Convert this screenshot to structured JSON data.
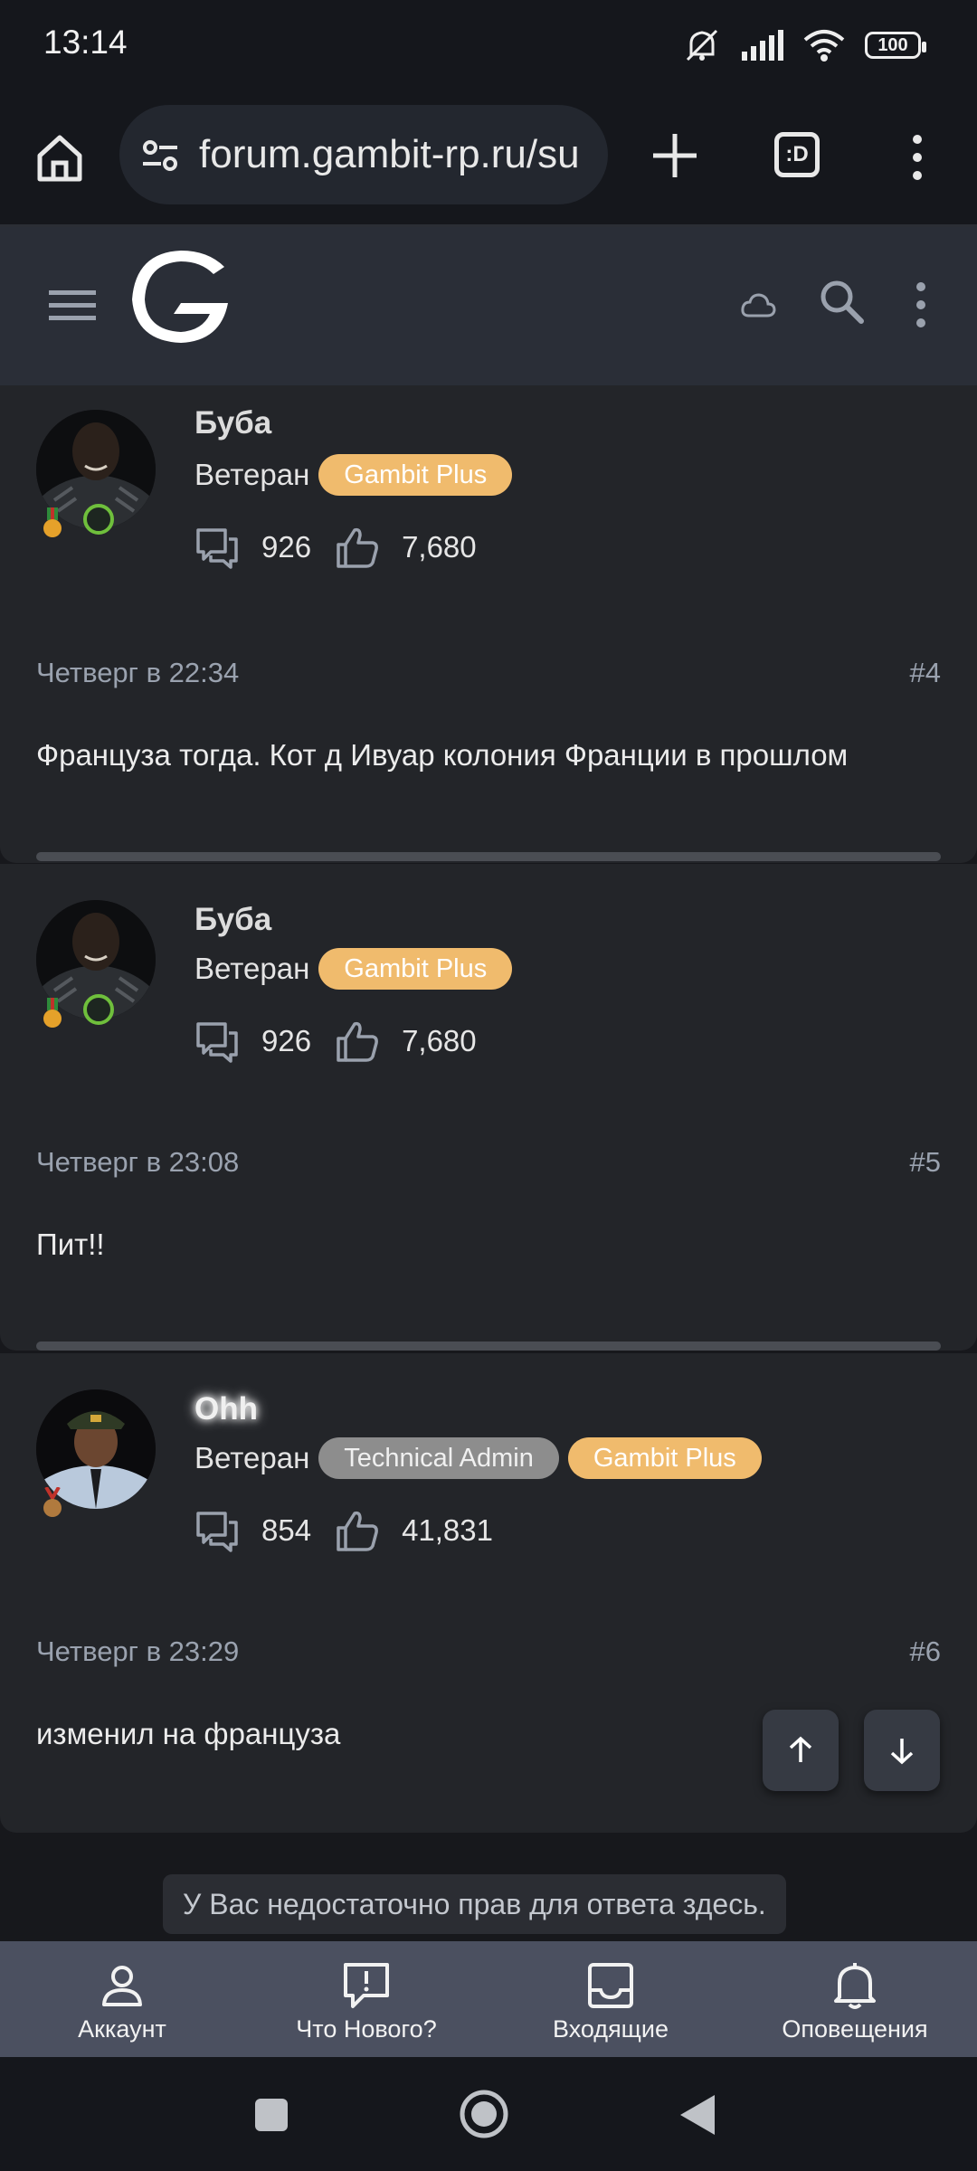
{
  "status_bar": {
    "time": "13:14",
    "battery": "100"
  },
  "browser": {
    "url": "forum.gambit-rp.ru/su",
    "tabs_label": ":D"
  },
  "posts": [
    {
      "username": "Буба",
      "role": "Ветеран",
      "badges": [
        "Gambit Plus"
      ],
      "messages": "926",
      "likes": "7,680",
      "date": "Четверг в 22:34",
      "number": "#4",
      "body": "Француза тогда. Кот д Ивуар колония Франции в прошлом"
    },
    {
      "username": "Буба",
      "role": "Ветеран",
      "badges": [
        "Gambit Plus"
      ],
      "messages": "926",
      "likes": "7,680",
      "date": "Четверг в 23:08",
      "number": "#5",
      "body": "Пит!!"
    },
    {
      "username": "Ohh",
      "role": "Ветеран",
      "badges": [
        "Technical Admin",
        "Gambit Plus"
      ],
      "messages": "854",
      "likes": "41,831",
      "date": "Четверг в 23:29",
      "number": "#6",
      "body": "изменил на француза"
    }
  ],
  "notice": "У Вас недостаточно прав для ответа здесь.",
  "bottom_nav": [
    {
      "label": "Аккаунт",
      "icon": "account-icon"
    },
    {
      "label": "Что Нового?",
      "icon": "whats-new-icon"
    },
    {
      "label": "Входящие",
      "icon": "inbox-icon"
    },
    {
      "label": "Оповещения",
      "icon": "bell-icon"
    }
  ],
  "colors": {
    "gold_badge": "#f0bb6d",
    "gray_badge": "#8d8d8d",
    "online": "#6fbf3c",
    "nav_bg": "#4b5060"
  }
}
